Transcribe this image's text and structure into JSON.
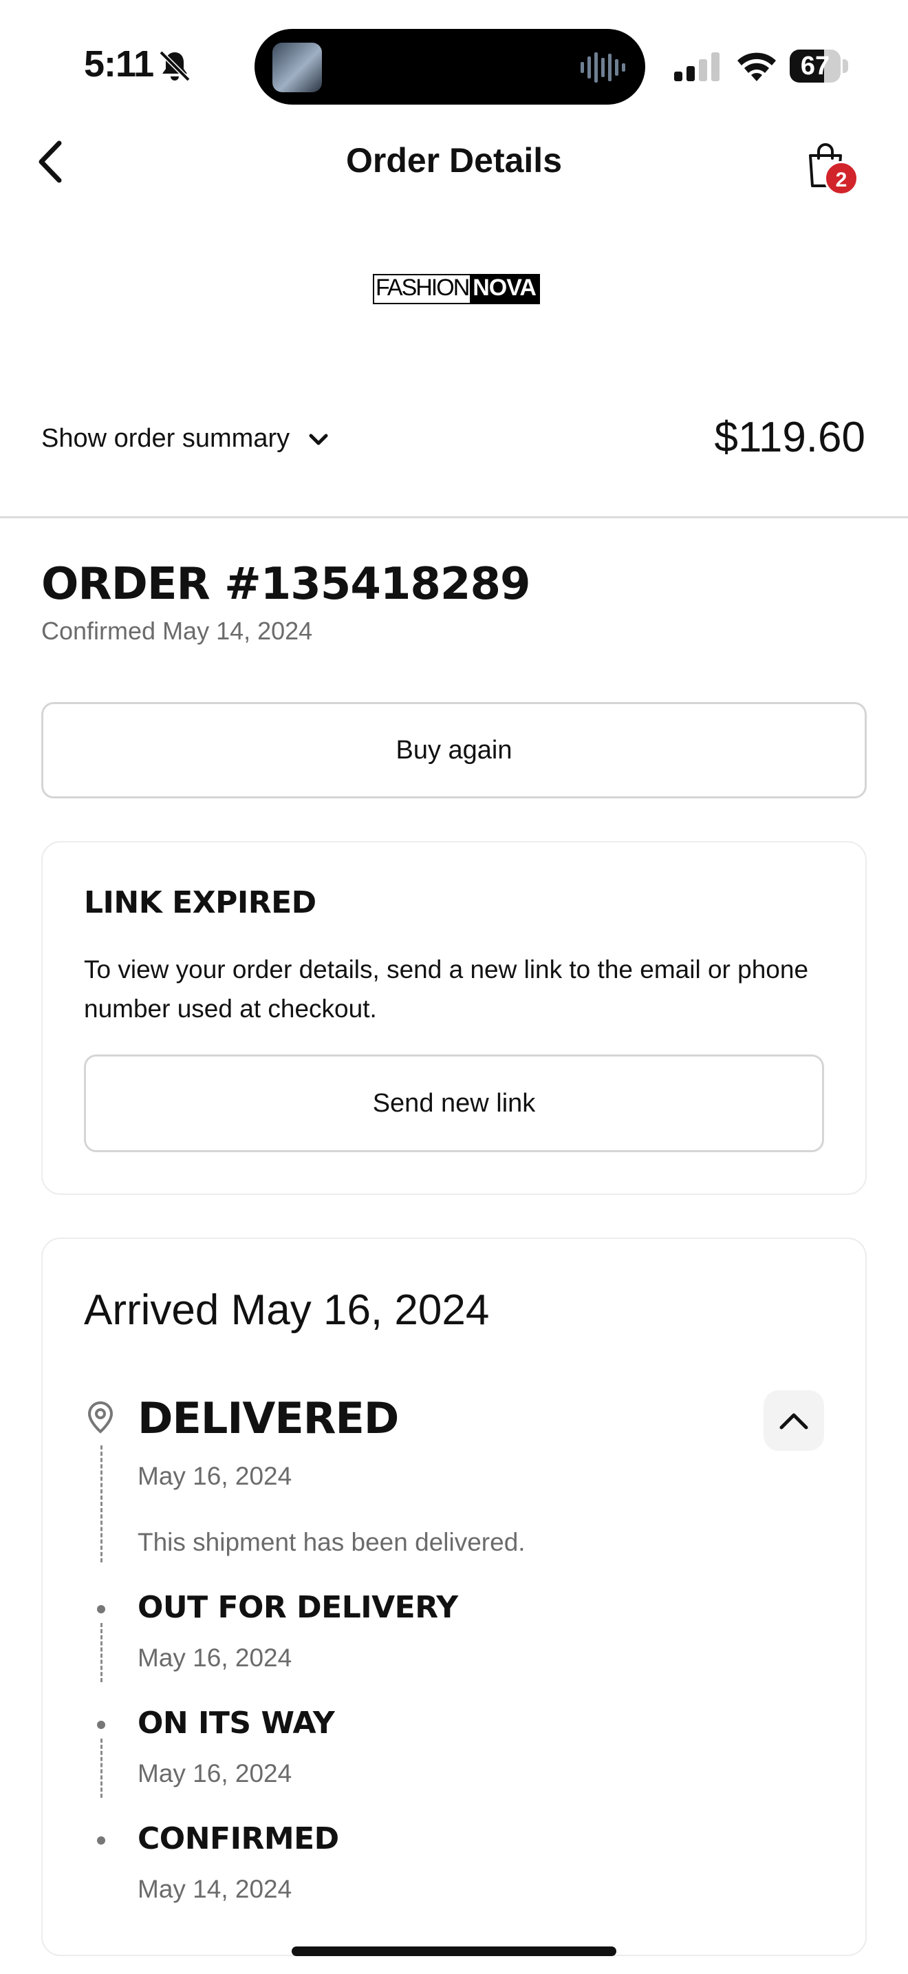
{
  "status_bar": {
    "time": "5:11",
    "battery": "67",
    "battery_level": 0.67,
    "icons": [
      "bell-slash-icon",
      "audio-wave-icon",
      "cellular-signal-icon",
      "wifi-icon",
      "battery-icon"
    ]
  },
  "nav": {
    "title": "Order Details",
    "cart_count": "2",
    "icons": [
      "back-chevron-icon",
      "shopping-bag-icon"
    ]
  },
  "logo": {
    "part1": "FASHION",
    "part2": "NOVA"
  },
  "summary": {
    "label": "Show order summary",
    "total": "$119.60"
  },
  "order": {
    "number": "ORDER #135418289",
    "confirmed": "Confirmed May 14, 2024",
    "buy_again": "Buy again"
  },
  "link_card": {
    "title": "LINK EXPIRED",
    "description": "To view your order details, send a new link to the email or phone number used at checkout.",
    "button": "Send new link"
  },
  "shipment": {
    "arrived": "Arrived May 16, 2024",
    "statuses": [
      {
        "title": "DELIVERED",
        "date": "May 16, 2024",
        "note": "This shipment has been delivered."
      },
      {
        "title": "OUT FOR DELIVERY",
        "date": "May 16, 2024"
      },
      {
        "title": "ON ITS WAY",
        "date": "May 16, 2024"
      },
      {
        "title": "CONFIRMED",
        "date": "May 14, 2024"
      }
    ]
  },
  "colors": {
    "badge": "#d1252b",
    "muted_text": "#6b6b6b",
    "border": "#d5d5d5"
  }
}
